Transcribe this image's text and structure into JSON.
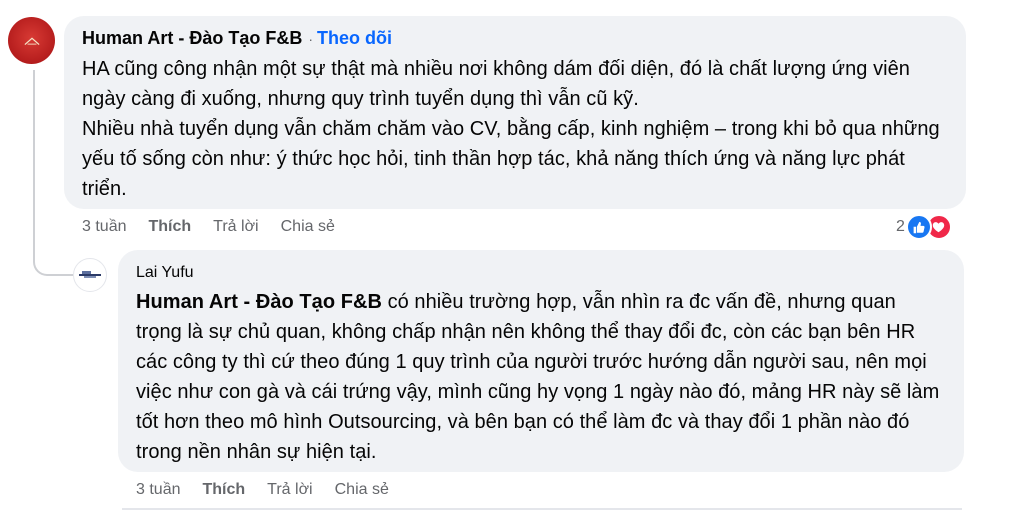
{
  "comment": {
    "author": "Human Art - Đào Tạo F&B",
    "separator": "·",
    "follow_label": "Theo dõi",
    "paragraphs": [
      "HA cũng công nhận một sự thật mà nhiều nơi không dám đối diện, đó là chất lượng ứng viên ngày càng đi xuống, nhưng quy trình tuyển dụng thì vẫn cũ kỹ.",
      "Nhiều nhà tuyển dụng vẫn chăm chăm vào CV, bằng cấp, kinh nghiệm – trong khi bỏ qua những yếu tố sống còn như: ý thức học hỏi, tinh thần hợp tác, khả năng thích ứng và năng lực phát triển."
    ],
    "time": "3 tuần",
    "like_label": "Thích",
    "reply_label": "Trả lời",
    "share_label": "Chia sẻ",
    "reaction_count": "2",
    "reaction_icons": [
      "like-icon",
      "love-icon"
    ],
    "avatar_color": "#c62828"
  },
  "reply": {
    "author": "Lai Yufu",
    "mention": "Human Art - Đào Tạo F&B",
    "text": " có nhiều trường hợp, vẫn nhìn ra đc vấn đề, nhưng quan trọng là sự chủ quan, không chấp nhận nên không thể thay đổi đc, còn các bạn bên HR các công ty thì cứ theo đúng 1 quy trình của người trước hướng dẫn người sau, nên mọi việc như con gà và cái trứng vậy, mình cũng hy vọng 1 ngày nào đó, mảng HR này sẽ làm tốt hơn theo mô hình Outsourcing, và bên bạn có thể làm đc và thay đổi 1 phần nào đó trong nền nhân sự hiện tại.",
    "time": "3 tuần",
    "like_label": "Thích",
    "reply_label": "Trả lời",
    "share_label": "Chia sẻ"
  },
  "colors": {
    "bubble": "#f0f2f5",
    "link_blue": "#0866ff",
    "meta_gray": "#65676b",
    "like_blue": "#1877f2",
    "love_red": "#f02849"
  }
}
